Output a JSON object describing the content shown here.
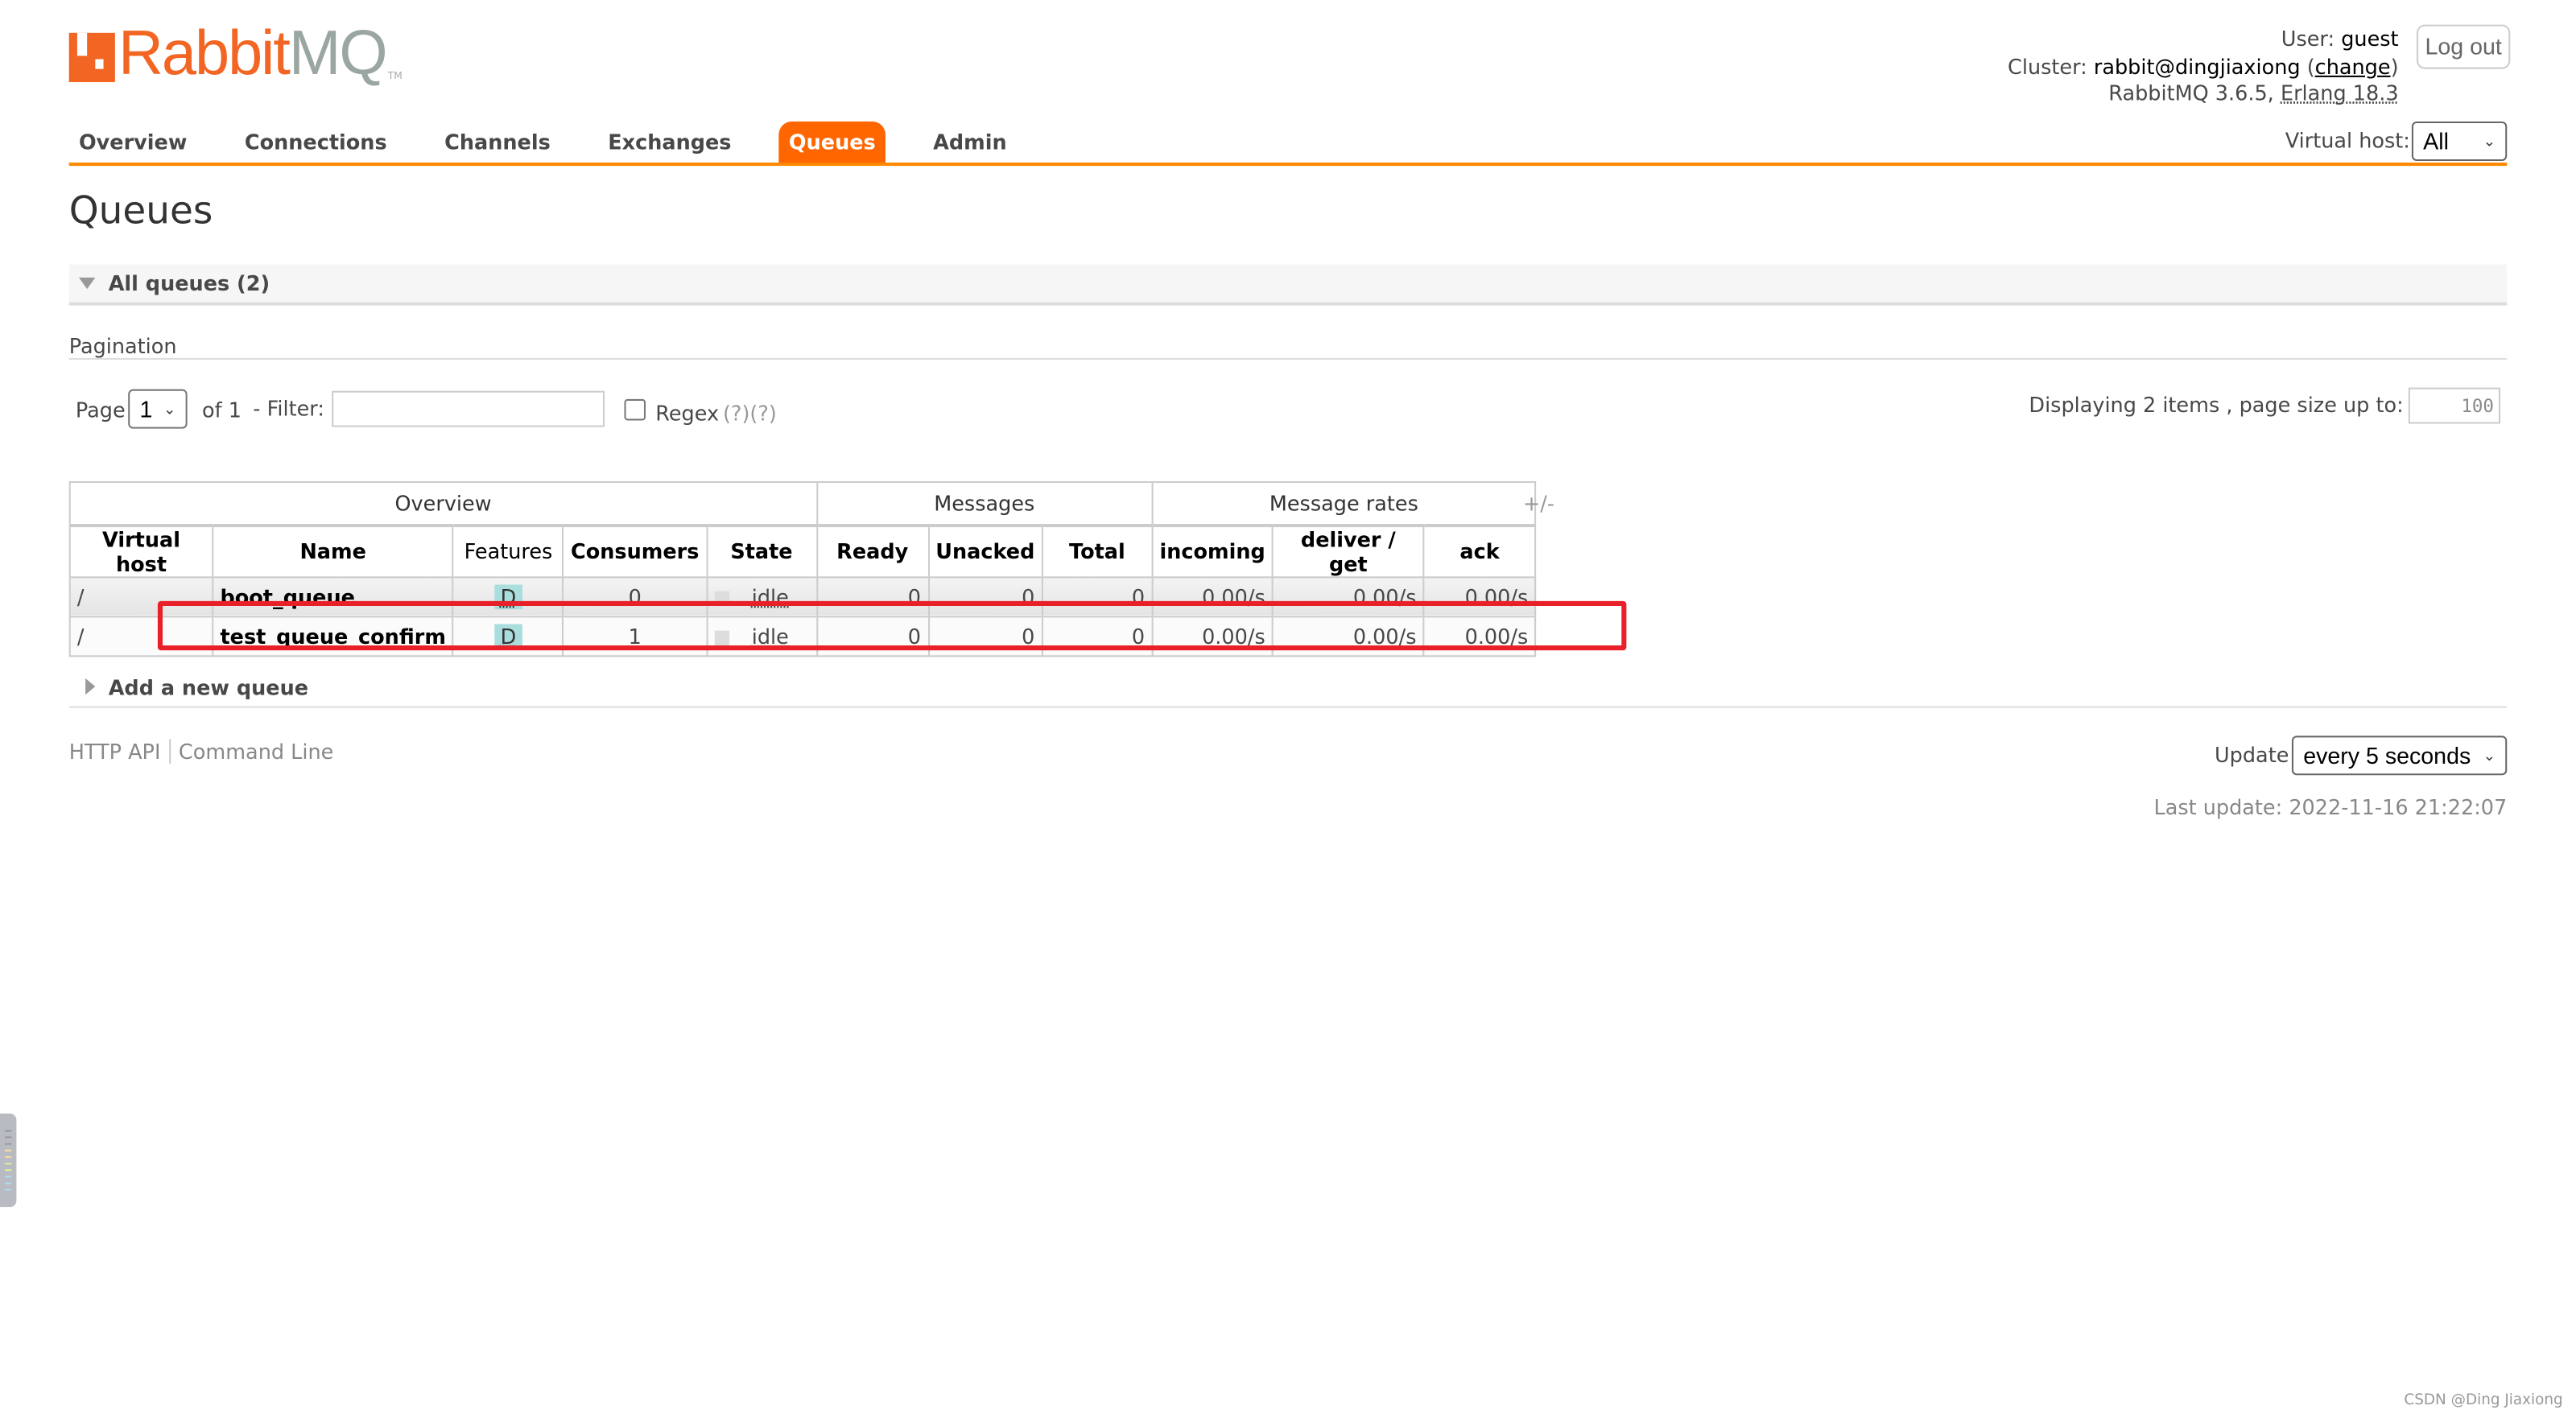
{
  "logo": {
    "text_main": "Rabbit",
    "text_mq": "MQ",
    "tm": "TM"
  },
  "header": {
    "user_label": "User:",
    "user": "guest",
    "cluster_label": "Cluster:",
    "cluster": "rabbit@dingjiaxiong",
    "change": "change",
    "version": "RabbitMQ 3.6.5,",
    "erlang": "Erlang 18.3",
    "logout": "Log out",
    "vhost_label": "Virtual host:",
    "vhost_value": "All"
  },
  "nav": {
    "tabs": [
      "Overview",
      "Connections",
      "Channels",
      "Exchanges",
      "Queues",
      "Admin"
    ],
    "active": "Queues"
  },
  "page_title": "Queues",
  "section_title": "All queues (2)",
  "pagination": {
    "label": "Pagination",
    "page_label": "Page",
    "page_value": "1",
    "of": "of 1",
    "filter_label": "- Filter:",
    "filter_value": "",
    "regex_label": "Regex",
    "regex_help": "(?)(?)",
    "displaying": "Displaying 2 items , page size up to:",
    "page_size": "100"
  },
  "table": {
    "groups": [
      "Overview",
      "Messages",
      "Message rates"
    ],
    "toggle": "+/-",
    "columns": [
      "Virtual host",
      "Name",
      "Features",
      "Consumers",
      "State",
      "Ready",
      "Unacked",
      "Total",
      "incoming",
      "deliver / get",
      "ack"
    ],
    "rows": [
      {
        "vhost": "/",
        "name": "boot_queue",
        "features": "D",
        "consumers": "0",
        "state": "idle",
        "ready": "0",
        "unacked": "0",
        "total": "0",
        "incoming": "0.00/s",
        "deliver": "0.00/s",
        "ack": "0.00/s"
      },
      {
        "vhost": "/",
        "name": "test_queue_confirm",
        "features": "D",
        "consumers": "1",
        "state": "idle",
        "ready": "0",
        "unacked": "0",
        "total": "0",
        "incoming": "0.00/s",
        "deliver": "0.00/s",
        "ack": "0.00/s"
      }
    ]
  },
  "add_queue": "Add a new queue",
  "footer": {
    "http_api": "HTTP API",
    "command_line": "Command Line",
    "update_label": "Update",
    "update_value": "every 5 seconds",
    "last_update": "Last update: 2022-11-16 21:22:07"
  },
  "watermark": "CSDN @Ding Jiaxiong",
  "colors": {
    "accent": "#ff6600",
    "nav_line": "#ff8800",
    "highlight_box": "#e8202a",
    "feature_badge": "#aadddd"
  }
}
